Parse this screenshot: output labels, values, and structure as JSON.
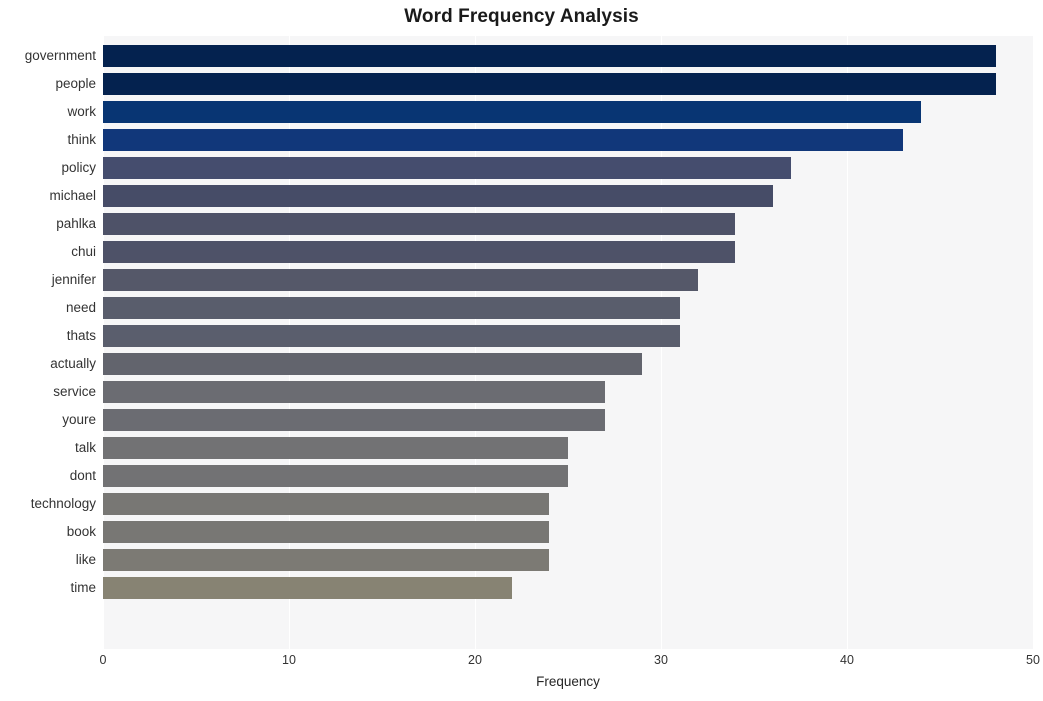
{
  "chart_data": {
    "type": "bar",
    "orientation": "horizontal",
    "title": "Word Frequency Analysis",
    "xlabel": "Frequency",
    "ylabel": "",
    "xlim": [
      0,
      50
    ],
    "xticks": [
      0,
      10,
      20,
      30,
      40,
      50
    ],
    "xtick_labels": [
      "0",
      "10",
      "20",
      "30",
      "40",
      "50"
    ],
    "grid": "vertical-white-on-light-gray",
    "legend": "none",
    "plot_background": "#f6f6f7",
    "categories": [
      "government",
      "people",
      "work",
      "think",
      "policy",
      "michael",
      "pahlka",
      "chui",
      "jennifer",
      "need",
      "thats",
      "actually",
      "service",
      "youre",
      "talk",
      "dont",
      "technology",
      "book",
      "like",
      "time"
    ],
    "values": [
      48,
      48,
      44,
      43,
      37,
      36,
      34,
      34,
      32,
      31,
      31,
      29,
      27,
      27,
      25,
      25,
      24,
      24,
      24,
      22
    ],
    "bar_colors": [
      "#04224f",
      "#04224f",
      "#083573",
      "#11377a",
      "#454d6e",
      "#464c67",
      "#4e5268",
      "#4e5268",
      "#555869",
      "#595d6c",
      "#5a5e6d",
      "#62646d",
      "#6b6c72",
      "#6b6c72",
      "#727274",
      "#727274",
      "#787774",
      "#787774",
      "#7c7a74",
      "#878373"
    ],
    "bars": [
      {
        "label": "government",
        "value": 48,
        "color": "#04224f"
      },
      {
        "label": "people",
        "value": 48,
        "color": "#04224f"
      },
      {
        "label": "work",
        "value": 44,
        "color": "#083573"
      },
      {
        "label": "think",
        "value": 43,
        "color": "#11377a"
      },
      {
        "label": "policy",
        "value": 37,
        "color": "#454d6e"
      },
      {
        "label": "michael",
        "value": 36,
        "color": "#464c67"
      },
      {
        "label": "pahlka",
        "value": 34,
        "color": "#4e5268"
      },
      {
        "label": "chui",
        "value": 34,
        "color": "#4e5268"
      },
      {
        "label": "jennifer",
        "value": 32,
        "color": "#555869"
      },
      {
        "label": "need",
        "value": 31,
        "color": "#595d6c"
      },
      {
        "label": "thats",
        "value": 31,
        "color": "#5a5e6d"
      },
      {
        "label": "actually",
        "value": 29,
        "color": "#62646d"
      },
      {
        "label": "service",
        "value": 27,
        "color": "#6b6c72"
      },
      {
        "label": "youre",
        "value": 27,
        "color": "#6b6c72"
      },
      {
        "label": "talk",
        "value": 25,
        "color": "#727274"
      },
      {
        "label": "dont",
        "value": 25,
        "color": "#727274"
      },
      {
        "label": "technology",
        "value": 24,
        "color": "#787774"
      },
      {
        "label": "book",
        "value": 24,
        "color": "#787774"
      },
      {
        "label": "like",
        "value": 24,
        "color": "#7c7a74"
      },
      {
        "label": "time",
        "value": 22,
        "color": "#878373"
      }
    ]
  }
}
